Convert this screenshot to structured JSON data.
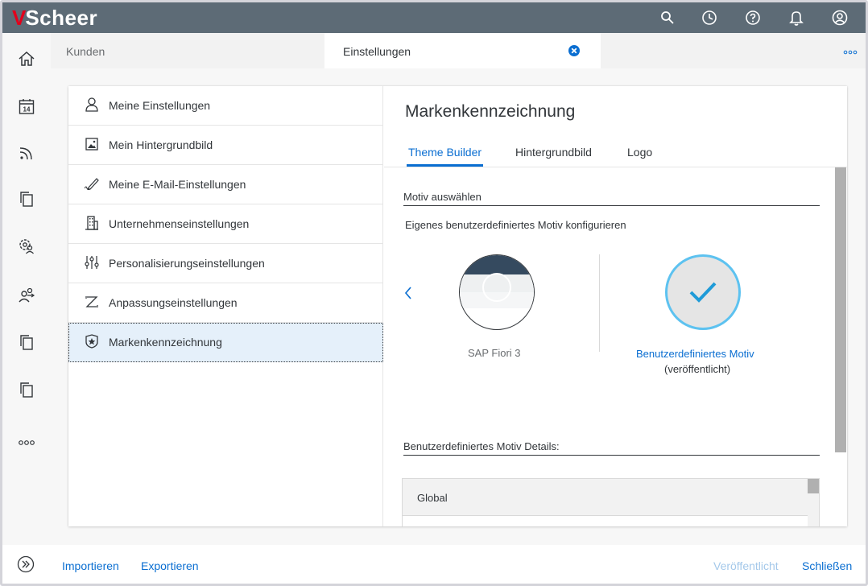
{
  "brand": {
    "logo_mark": "V",
    "logo_text": "Scheer"
  },
  "shell": {
    "icons": [
      "search-icon",
      "history-icon",
      "help-icon",
      "notifications-icon",
      "user-icon"
    ]
  },
  "left_nav": {
    "icons": [
      "home-icon",
      "calendar-icon",
      "feed-icon",
      "copy-icon",
      "group-settings-icon",
      "users-icon",
      "copy-icon",
      "copy-icon",
      "more-icon"
    ],
    "calendar_day": "14",
    "expand_icon": "expand-icon"
  },
  "tabs": [
    {
      "label": "Kunden"
    },
    {
      "label": "Einstellungen"
    }
  ],
  "master": {
    "items": [
      {
        "label": "Meine Einstellungen",
        "icon": "person-icon"
      },
      {
        "label": "Mein Hintergrundbild",
        "icon": "image-icon"
      },
      {
        "label": "Meine E-Mail-Einstellungen",
        "icon": "edit-icon"
      },
      {
        "label": "Unternehmenseinstellungen",
        "icon": "building-icon"
      },
      {
        "label": "Personalisierungseinstellungen",
        "icon": "sliders-icon"
      },
      {
        "label": "Anpassungseinstellungen",
        "icon": "customize-icon"
      },
      {
        "label": "Markenkennzeichnung",
        "icon": "badge-icon"
      }
    ],
    "selected_index": 6
  },
  "detail": {
    "title": "Markenkennzeichnung",
    "tabs": [
      "Theme Builder",
      "Hintergrundbild",
      "Logo"
    ],
    "active_tab": "Theme Builder",
    "section_heading": "Motiv auswählen",
    "section_desc": "Eigenes benutzerdefiniertes Motiv konfigurieren",
    "theme_name": "SAP Fiori 3",
    "custom_theme_name": "Benutzerdefiniertes Motiv",
    "custom_theme_status": "(veröffentlicht)",
    "details_heading": "Benutzerdefiniertes Motiv Details:",
    "global_label": "Global"
  },
  "footer": {
    "import_label": "Importieren",
    "export_label": "Exportieren",
    "publish_label": "Veröffentlicht",
    "close_label": "Schließen"
  },
  "colors": {
    "shell": "#5d6b76",
    "accent": "#0a6ed1",
    "brand_red": "#e3001b",
    "selection": "#e5f0fa",
    "check_ring": "#5dc2f0"
  }
}
